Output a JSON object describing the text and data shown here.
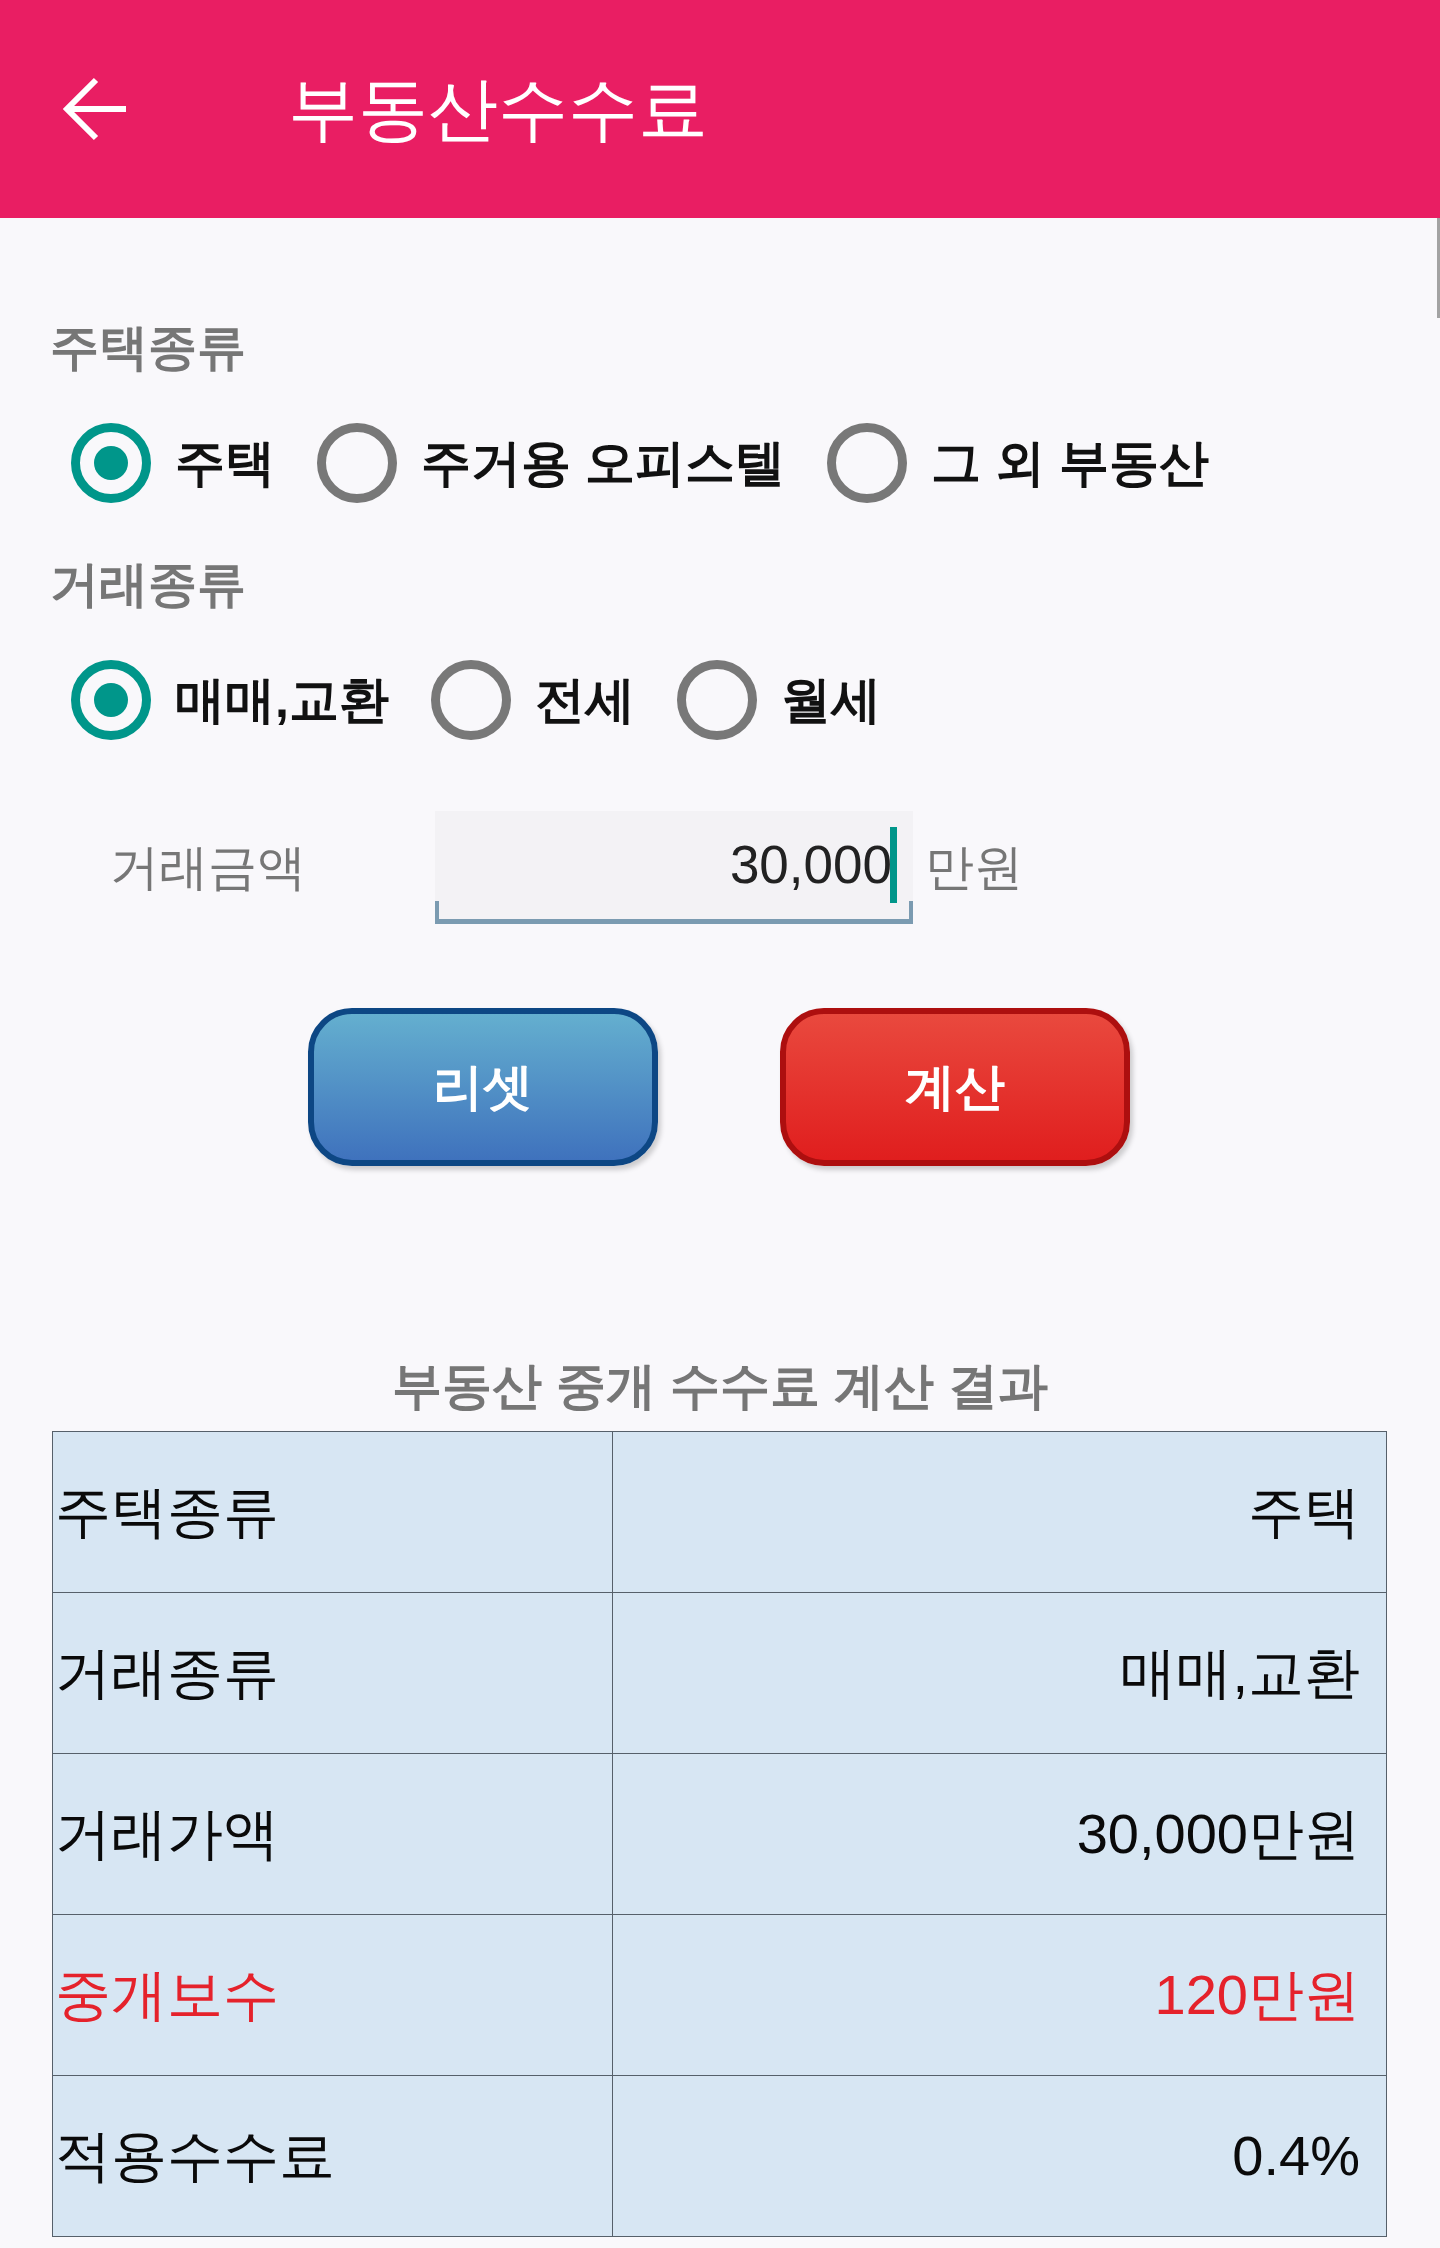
{
  "app_bar": {
    "title": "부동산수수료"
  },
  "house_type": {
    "label": "주택종류",
    "options": [
      {
        "label": "주택",
        "selected": true
      },
      {
        "label": "주거용 오피스텔",
        "selected": false
      },
      {
        "label": "그 외 부동산",
        "selected": false
      }
    ]
  },
  "deal_type": {
    "label": "거래종류",
    "options": [
      {
        "label": "매매,교환",
        "selected": true
      },
      {
        "label": "전세",
        "selected": false
      },
      {
        "label": "월세",
        "selected": false
      }
    ]
  },
  "amount": {
    "label": "거래금액",
    "value": "30,000",
    "focused": true,
    "unit": "만원"
  },
  "buttons": [
    {
      "label": "리셋",
      "kind": "reset"
    },
    {
      "label": "계산",
      "kind": "calculate"
    }
  ],
  "result": {
    "title": "부동산 중개 수수료 계산 결과",
    "rows": [
      {
        "label": "주택종류",
        "value": "주택",
        "highlighted": false
      },
      {
        "label": "거래종류",
        "value": "매매,교환",
        "highlighted": false
      },
      {
        "label": "거래가액",
        "value": "30,000만원",
        "highlighted": false
      },
      {
        "label": "중개보수",
        "value": "120만원",
        "highlighted": true
      },
      {
        "label": "적용수수료",
        "value": "0.4%",
        "highlighted": false
      }
    ]
  }
}
